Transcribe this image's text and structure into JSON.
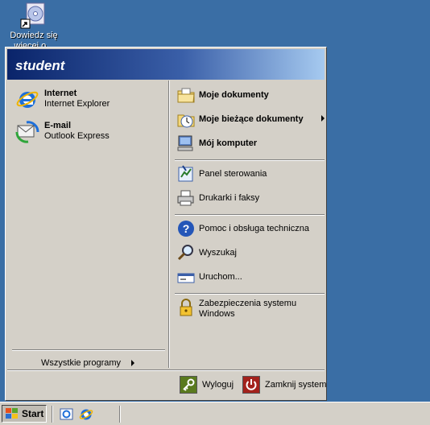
{
  "desktop": {
    "icon_label_line1": "Dowiedz się",
    "icon_label_line2": "więcej o..."
  },
  "start_menu": {
    "user": "student",
    "pinned": [
      {
        "title": "Internet",
        "subtitle": "Internet Explorer",
        "icon": "internet-explorer-icon"
      },
      {
        "title": "E-mail",
        "subtitle": "Outlook Express",
        "icon": "outlook-express-icon"
      }
    ],
    "all_programs": "Wszystkie programy",
    "right": {
      "my_documents": "Moje dokumenty",
      "recent_documents": "Moje bieżące dokumenty",
      "my_computer": "Mój komputer",
      "control_panel": "Panel sterowania",
      "printers": "Drukarki i faksy",
      "help": "Pomoc i obsługa techniczna",
      "search": "Wyszukaj",
      "run": "Uruchom...",
      "security_line1": "Zabezpieczenia systemu",
      "security_line2": "Windows"
    },
    "logoff": "Wyloguj",
    "shutdown": "Zamknij system"
  },
  "taskbar": {
    "start_label": "Start"
  },
  "colors": {
    "desktop": "#3a6ea5",
    "header_start": "#0a246a",
    "header_end": "#a6caf0",
    "menu_face": "#d4d0c8",
    "logoff_green": "#5a7a1e",
    "shutdown_red": "#a3221c"
  }
}
